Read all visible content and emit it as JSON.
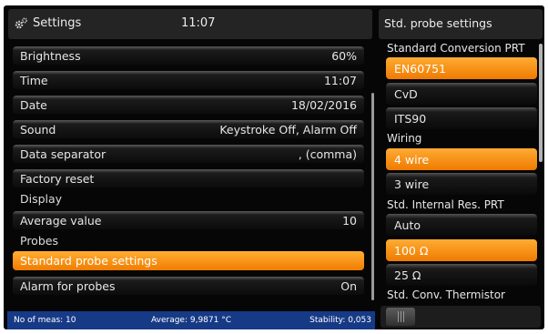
{
  "header": {
    "title": "Settings",
    "time": "11:07"
  },
  "menu": {
    "brightness": {
      "label": "Brightness",
      "value": "60%"
    },
    "time": {
      "label": "Time",
      "value": "11:07"
    },
    "date": {
      "label": "Date",
      "value": "18/02/2016"
    },
    "sound": {
      "label": "Sound",
      "value": "Keystroke Off, Alarm Off"
    },
    "separator": {
      "label": "Data separator",
      "value": ", (comma)"
    },
    "factory_reset": {
      "label": "Factory reset"
    },
    "display_section": "Display",
    "average": {
      "label": "Average value",
      "value": "10"
    },
    "probes_section": "Probes",
    "standard_probe": {
      "label": "Standard probe settings"
    },
    "alarm": {
      "label": "Alarm for probes",
      "value": "On"
    }
  },
  "status": {
    "meas": "No of meas: 10",
    "average": "Average: 9,9871 °C",
    "stability": "Stability: 0,053"
  },
  "panel": {
    "title": "Std. probe settings",
    "conversion": {
      "label": "Standard Conversion PRT",
      "options": [
        "EN60751",
        "CvD",
        "ITS90"
      ],
      "selected": "EN60751"
    },
    "wiring": {
      "label": "Wiring",
      "options": [
        "4 wire",
        "3 wire"
      ],
      "selected": "4 wire"
    },
    "internal": {
      "label": "Std. Internal Res. PRT",
      "options": [
        "Auto",
        "100 Ω",
        "25 Ω"
      ],
      "selected": "100 Ω"
    },
    "thermistor": {
      "label": "Std. Conv. Thermistor"
    }
  },
  "colors": {
    "accent": "#f58a0a",
    "status_bar": "#173a86",
    "background": "#060606"
  }
}
